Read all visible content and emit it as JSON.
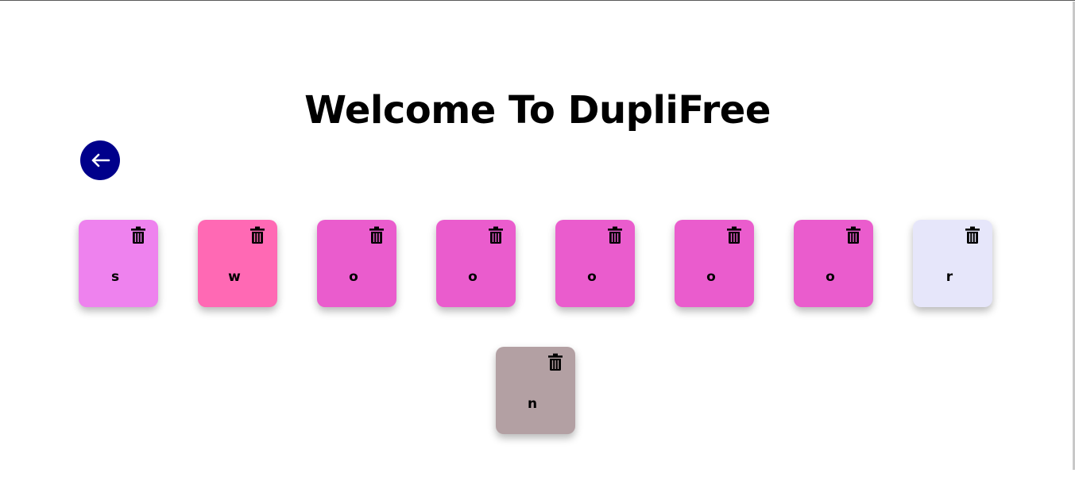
{
  "title": "Welcome To DupliFree",
  "back_button": {
    "icon": "arrow-left-icon",
    "color": "#00008b"
  },
  "cards": [
    {
      "letter": "s",
      "color": "#ee82ee",
      "icon": "trash-icon"
    },
    {
      "letter": "w",
      "color": "#ff69b4",
      "icon": "trash-icon"
    },
    {
      "letter": "o",
      "color": "#ea5ccd",
      "icon": "trash-icon"
    },
    {
      "letter": "o",
      "color": "#ea5ccd",
      "icon": "trash-icon"
    },
    {
      "letter": "o",
      "color": "#ea5ccd",
      "icon": "trash-icon"
    },
    {
      "letter": "o",
      "color": "#ea5ccd",
      "icon": "trash-icon"
    },
    {
      "letter": "o",
      "color": "#ea5ccd",
      "icon": "trash-icon"
    },
    {
      "letter": "r",
      "color": "#e6e6fa",
      "icon": "trash-icon"
    },
    {
      "letter": "n",
      "color": "#b3a0a3",
      "icon": "trash-icon"
    }
  ]
}
